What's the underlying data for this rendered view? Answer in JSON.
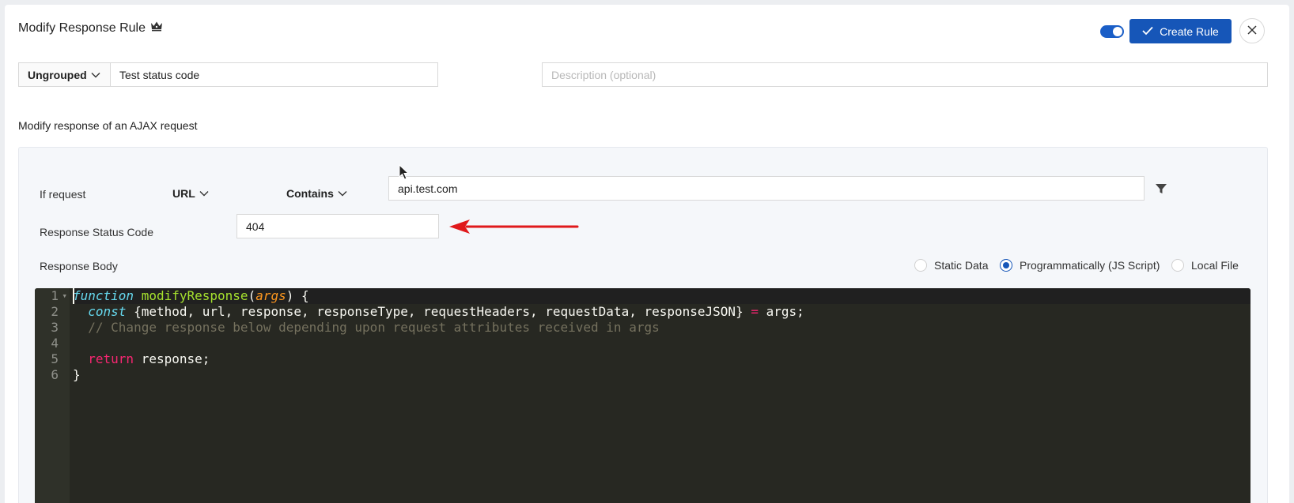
{
  "header": {
    "title": "Modify Response Rule",
    "toggle_on": true,
    "create_label": "Create Rule"
  },
  "rule": {
    "group_label": "Ungrouped",
    "name_value": "Test status code",
    "description_placeholder": "Description (optional)",
    "subtitle": "Modify response of an AJAX request"
  },
  "condition": {
    "if_label": "If request",
    "source_label": "URL",
    "operator_label": "Contains",
    "url_value": "api.test.com"
  },
  "status": {
    "label": "Response Status Code",
    "value": "404"
  },
  "body": {
    "label": "Response Body",
    "options": [
      {
        "label": "Static Data",
        "selected": false
      },
      {
        "label": "Programmatically (JS Script)",
        "selected": true
      },
      {
        "label": "Local File",
        "selected": false
      }
    ]
  },
  "editor": {
    "line_numbers": [
      "1",
      "2",
      "3",
      "4",
      "5",
      "6"
    ]
  },
  "colors": {
    "primary": "#1656b8",
    "annotation_arrow": "#e0191b",
    "editor_bg": "#272822"
  },
  "icons": [
    "crown-icon",
    "check-icon",
    "close-icon",
    "chevron-down-icon",
    "filter-icon",
    "red-arrow-annotation"
  ]
}
